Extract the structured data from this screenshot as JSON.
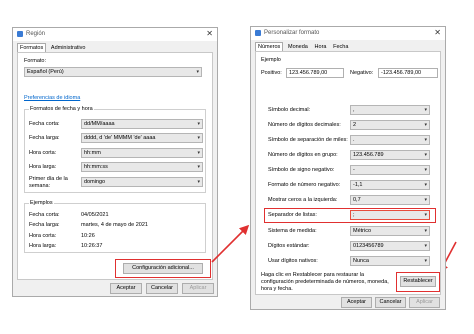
{
  "left_window": {
    "title": "Región",
    "tabs": [
      "Formatos",
      "Administrativo"
    ],
    "format_label": "Formato:",
    "format_value": "Español (Perú)",
    "language_prefs_link": "Preferencias de idioma",
    "date_time_group_title": "Formatos de fecha y hora",
    "rows": [
      {
        "label": "Fecha corta:",
        "value": "dd/MM/aaaa"
      },
      {
        "label": "Fecha larga:",
        "value": "dddd, d 'de' MMMM 'de' aaaa"
      },
      {
        "label": "Hora corta:",
        "value": "hh:mm"
      },
      {
        "label": "Hora larga:",
        "value": "hh:mm:ss"
      },
      {
        "label": "Primer día de la semana:",
        "value": "domingo"
      }
    ],
    "examples_group_title": "Ejemplos",
    "examples": [
      {
        "label": "Fecha corta:",
        "value": "04/05/2021"
      },
      {
        "label": "Fecha larga:",
        "value": "martes, 4 de mayo de 2021"
      },
      {
        "label": "Hora corta:",
        "value": "10:26"
      },
      {
        "label": "Hora larga:",
        "value": "10:26:37"
      }
    ],
    "additional_button": "Configuración adicional...",
    "accept_button": "Aceptar",
    "cancel_button": "Cancelar",
    "apply_button": "Aplicar"
  },
  "right_window": {
    "title": "Personalizar formato",
    "tabs": [
      "Números",
      "Moneda",
      "Hora",
      "Fecha"
    ],
    "example_group_title": "Ejemplo",
    "positive_label": "Positivo:",
    "positive_value": "123.456.789,00",
    "negative_label": "Negativo:",
    "negative_value": "-123.456.789,00",
    "rows": [
      {
        "label": "Símbolo decimal:",
        "value": ","
      },
      {
        "label": "Número de dígitos decimales:",
        "value": "2"
      },
      {
        "label": "Símbolo de separación de miles:",
        "value": "."
      },
      {
        "label": "Número de dígitos en grupo:",
        "value": "123.456.789"
      },
      {
        "label": "Símbolo de signo negativo:",
        "value": "-"
      },
      {
        "label": "Formato de número negativo:",
        "value": "-1,1"
      },
      {
        "label": "Mostrar ceros a la izquierda:",
        "value": "0,7"
      },
      {
        "label": "Separador de listas:",
        "value": ";"
      },
      {
        "label": "Sistema de medida:",
        "value": "Métrico"
      },
      {
        "label": "Dígitos estándar:",
        "value": "0123456789"
      },
      {
        "label": "Usar dígitos nativos:",
        "value": "Nunca"
      }
    ],
    "reset_note": "Haga clic en Restablecer para restaurar la configuración predeterminada de números, moneda, hora y fecha.",
    "reset_button": "Restablecer",
    "accept_button": "Aceptar",
    "cancel_button": "Cancelar",
    "apply_button": "Aplicar"
  },
  "colors": {
    "highlight": "#e03030",
    "link": "#0066cc"
  }
}
